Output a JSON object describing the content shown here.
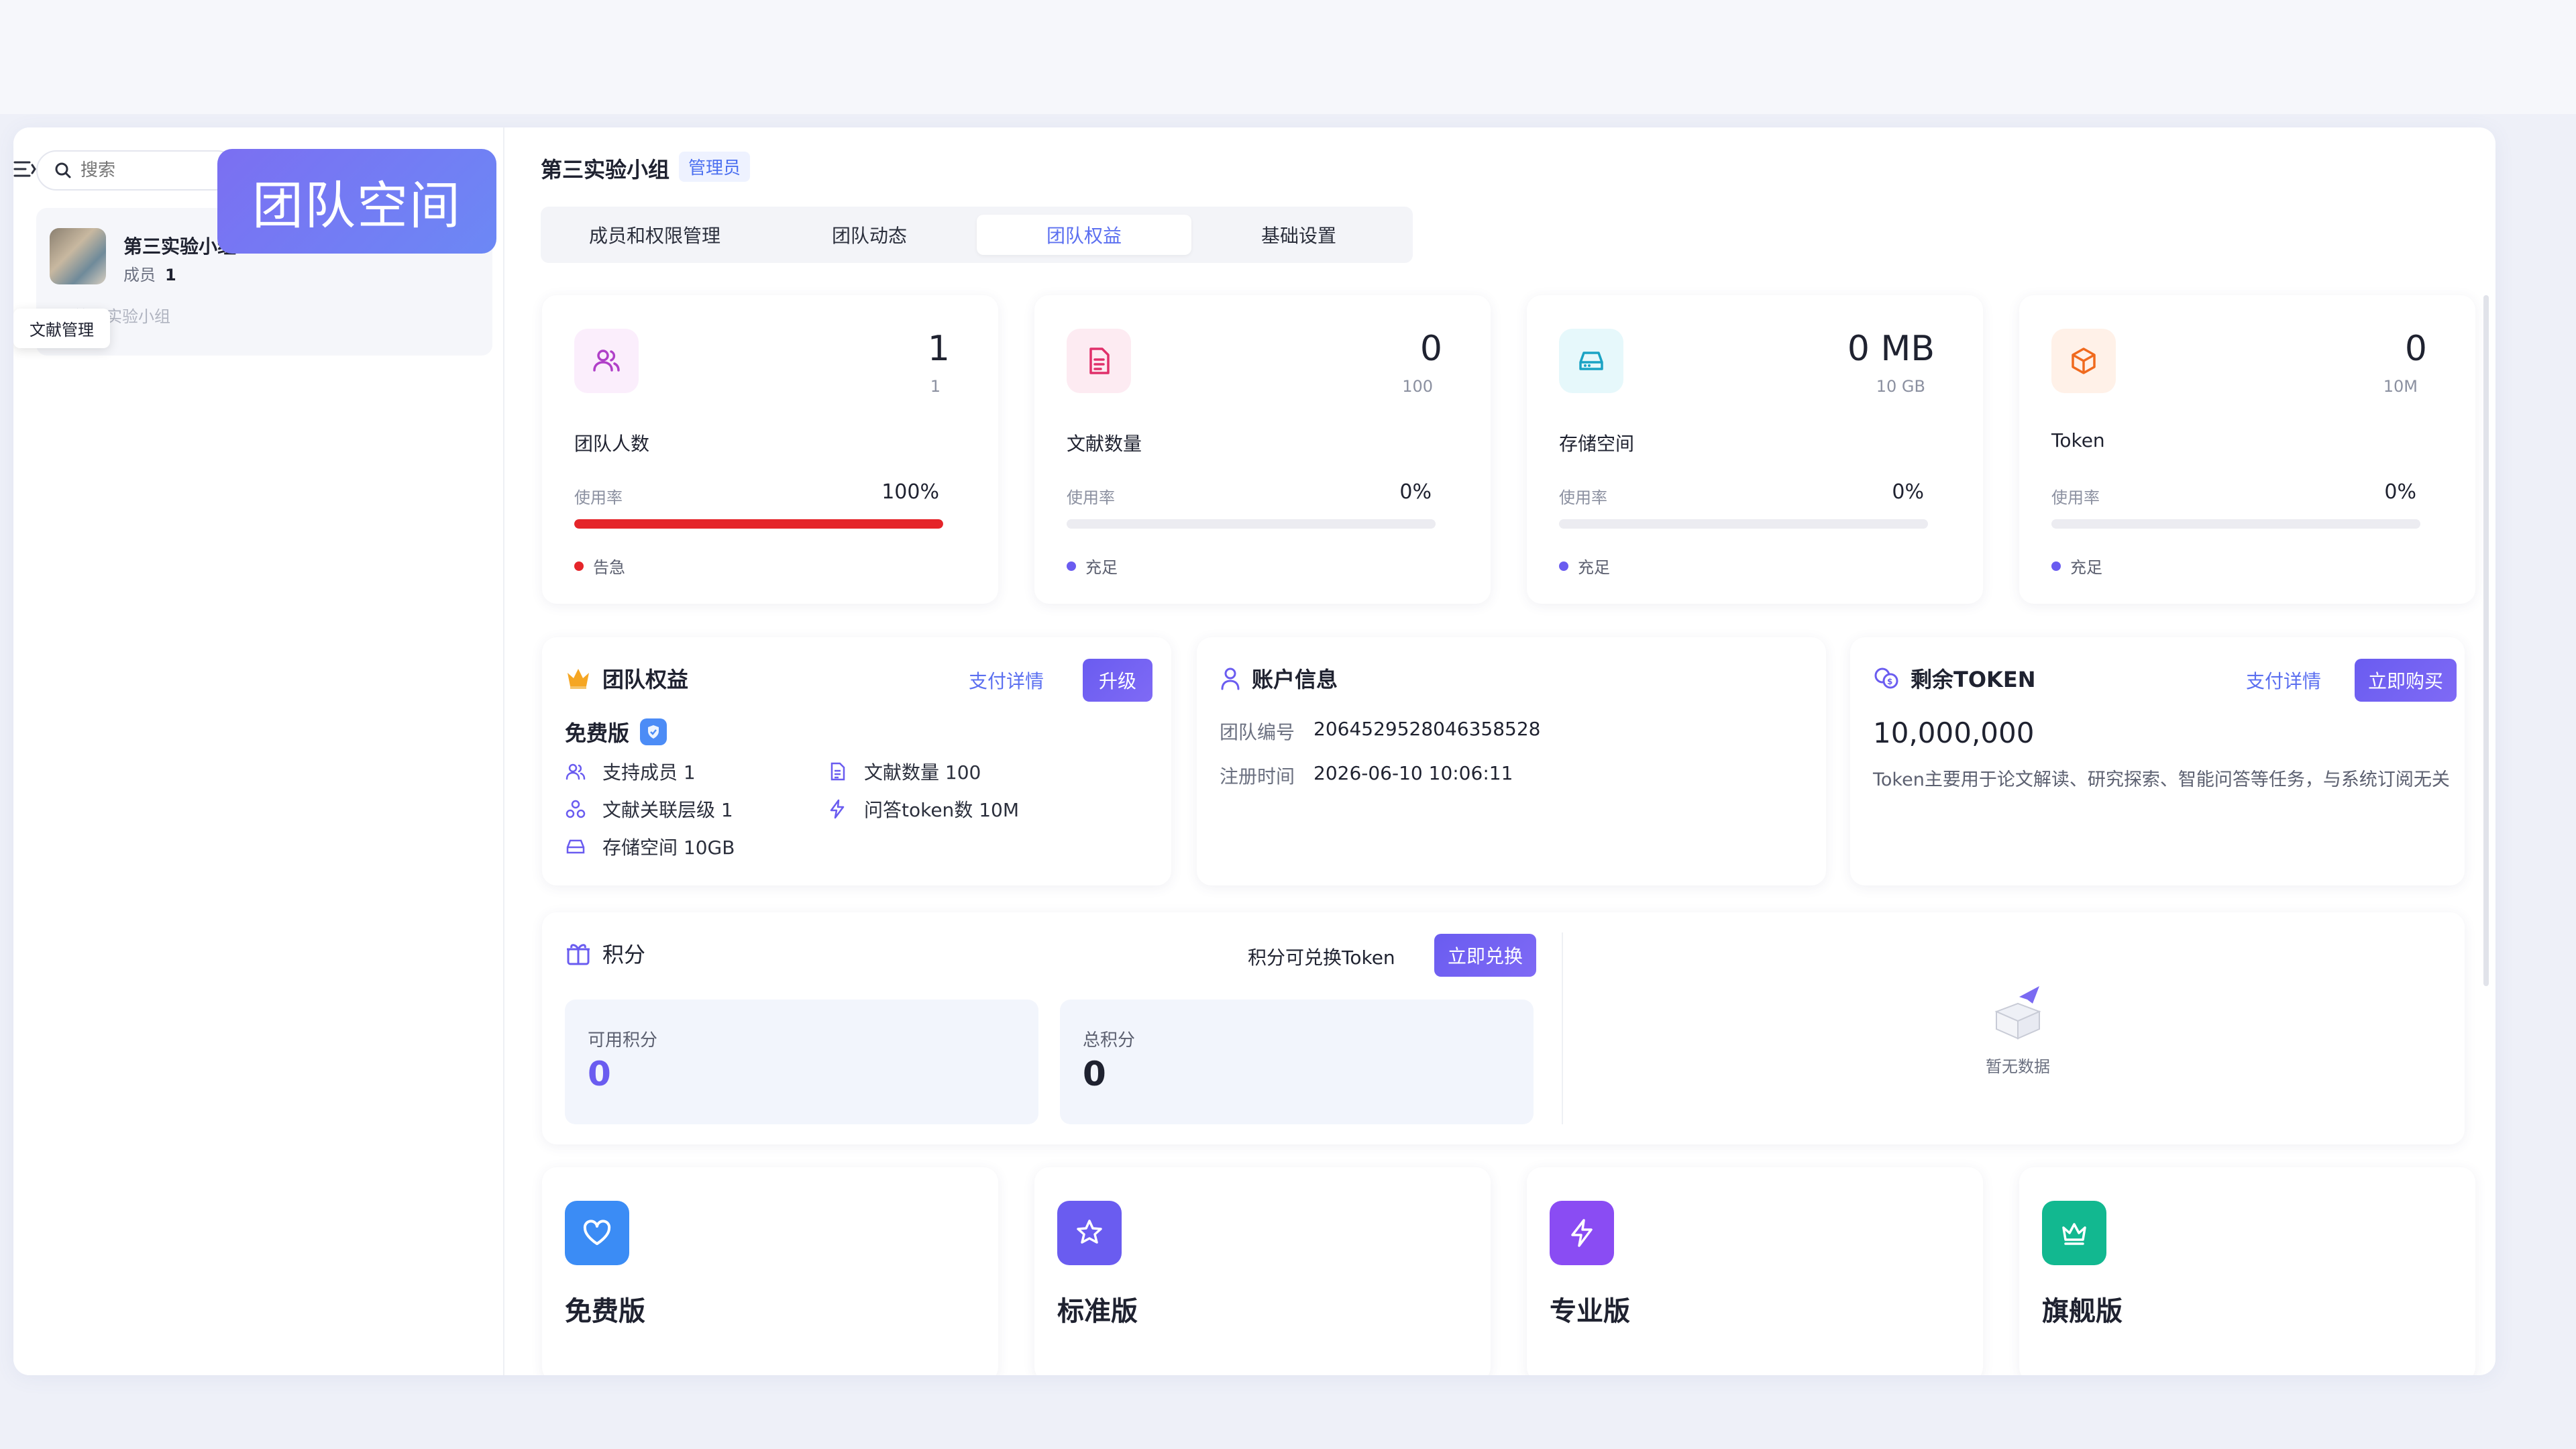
{
  "overlay_title": "团队空间",
  "sidebar": {
    "search_placeholder": "搜索",
    "team": {
      "name": "第三实验小组",
      "members_label": "成员",
      "members_count": "1",
      "sub": "第三实验小组"
    },
    "tooltip": "文献管理"
  },
  "header": {
    "title": "第三实验小组",
    "role": "管理员"
  },
  "tabs": [
    {
      "label": "成员和权限管理",
      "active": false
    },
    {
      "label": "团队动态",
      "active": false
    },
    {
      "label": "团队权益",
      "active": true
    },
    {
      "label": "基础设置",
      "active": false
    }
  ],
  "stats": [
    {
      "icon": "team-members-icon",
      "value": "1",
      "limit": "1",
      "label": "团队人数",
      "usage_label": "使用率",
      "usage": "100%",
      "usage_fraction": 1.0,
      "status": "告急",
      "status_color": "#e5252a",
      "bar_color": "#e5252a",
      "icon_bg": "#fbeefc",
      "icon_color": "#b040c8"
    },
    {
      "icon": "document-icon",
      "value": "0",
      "limit": "100",
      "label": "文献数量",
      "usage_label": "使用率",
      "usage": "0%",
      "usage_fraction": 0.0,
      "status": "充足",
      "status_color": "#6a5cf0",
      "bar_color": "#6a5cf0",
      "icon_bg": "#fdebf2",
      "icon_color": "#e0306a"
    },
    {
      "icon": "storage-icon",
      "value": "0 MB",
      "limit": "10 GB",
      "label": "存储空间",
      "usage_label": "使用率",
      "usage": "0%",
      "usage_fraction": 0.0,
      "status": "充足",
      "status_color": "#6a5cf0",
      "bar_color": "#6a5cf0",
      "icon_bg": "#e6f8fb",
      "icon_color": "#1aa3c4"
    },
    {
      "icon": "token-box-icon",
      "value": "0",
      "limit": "10M",
      "label": "Token",
      "usage_label": "使用率",
      "usage": "0%",
      "usage_fraction": 0.0,
      "status": "充足",
      "status_color": "#6a5cf0",
      "bar_color": "#6a5cf0",
      "icon_bg": "#fff1e8",
      "icon_color": "#f06a1e"
    }
  ],
  "benefits": {
    "title": "团队权益",
    "detail_link": "支付详情",
    "upgrade_btn": "升级",
    "plan": "免费版",
    "features": [
      "支持成员 1",
      "文献数量 100",
      "文献关联层级 1",
      "问答token数 10M",
      "存储空间 10GB"
    ]
  },
  "account": {
    "title": "账户信息",
    "team_id_label": "团队编号",
    "team_id": "2064529528046358528",
    "reg_label": "注册时间",
    "reg_time": "2026-06-10 10:06:11"
  },
  "token": {
    "title": "剩余TOKEN",
    "detail_link": "支付详情",
    "buy_btn": "立即购买",
    "amount": "10,000,000",
    "desc": "Token主要用于论文解读、研究探索、智能问答等任务，与系统订阅无关"
  },
  "points": {
    "title": "积分",
    "exchange_label": "积分可兑换Token",
    "exchange_btn": "立即兑换",
    "available_label": "可用积分",
    "available": "0",
    "total_label": "总积分",
    "total": "0",
    "empty_text": "暂无数据"
  },
  "plans": [
    {
      "name": "免费版",
      "icon": "heart-icon",
      "color": "#3b8cf5"
    },
    {
      "name": "标准版",
      "icon": "star-icon",
      "color": "#6a5cf0"
    },
    {
      "name": "专业版",
      "icon": "lightning-icon",
      "color": "#8a4cf3"
    },
    {
      "name": "旗舰版",
      "icon": "crown-icon",
      "color": "#12b890"
    }
  ]
}
